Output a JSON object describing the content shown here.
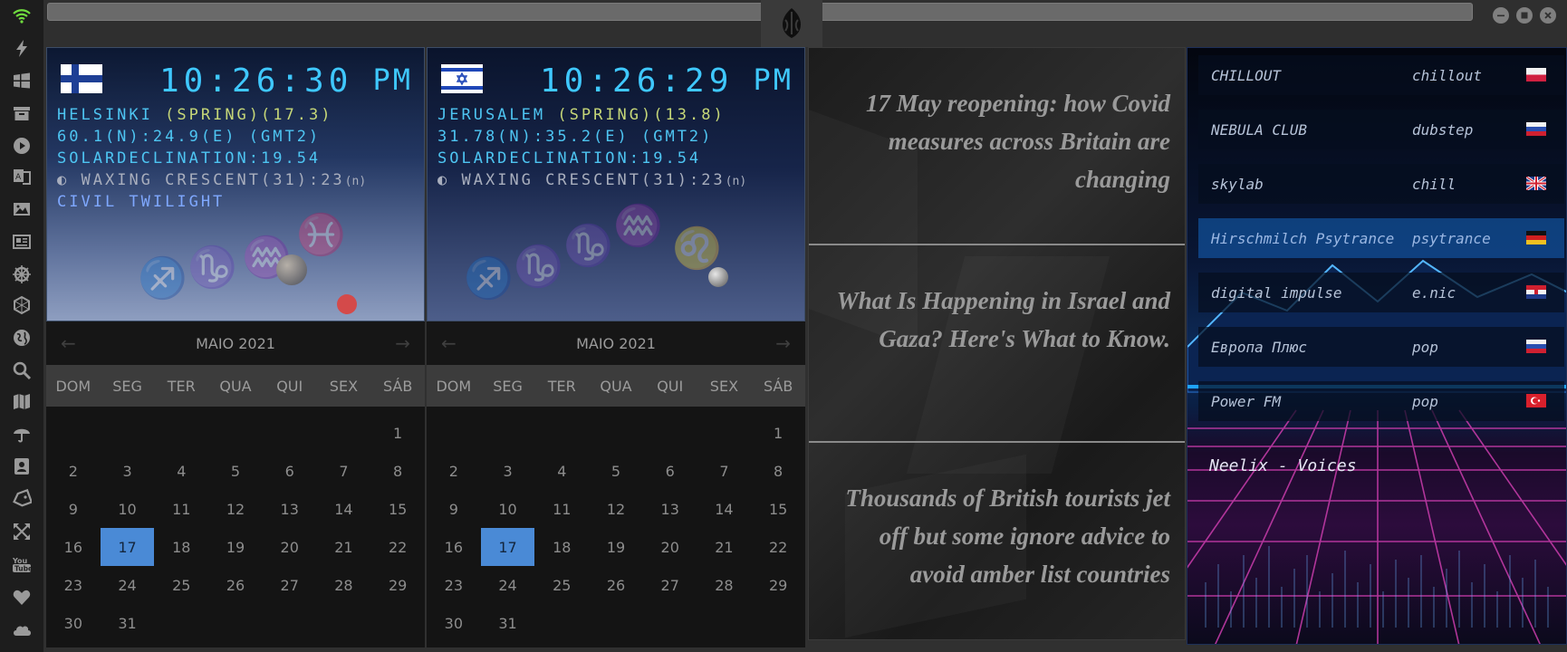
{
  "topbar": {
    "search_value": "",
    "window_controls": [
      "minimize-icon",
      "maximize-icon",
      "close-icon"
    ],
    "logo": "rebel-alliance-logo"
  },
  "sidebar": {
    "items": [
      {
        "name": "wifi-icon"
      },
      {
        "name": "lightning-icon"
      },
      {
        "name": "windows-icon"
      },
      {
        "name": "archive-icon"
      },
      {
        "name": "play-circle-icon"
      },
      {
        "name": "translate-icon"
      },
      {
        "name": "image-icon"
      },
      {
        "name": "newspaper-icon"
      },
      {
        "name": "helm-icon"
      },
      {
        "name": "hexagon-icon"
      },
      {
        "name": "globe-icon"
      },
      {
        "name": "search-icon"
      },
      {
        "name": "map-icon"
      },
      {
        "name": "umbrella-icon"
      },
      {
        "name": "contact-icon"
      },
      {
        "name": "tag-icon"
      },
      {
        "name": "expand-icon"
      },
      {
        "name": "youtube-icon"
      },
      {
        "name": "heart-icon"
      },
      {
        "name": "cloud-icon"
      }
    ]
  },
  "clocks": [
    {
      "flag": "finland",
      "time": "10:26:30",
      "ampm": "PM",
      "city": "HELSINKI",
      "season": "(SPRING)",
      "temp": "(17.3)",
      "coords": "60.1(N):24.9(E) (GMT2)",
      "solar": "SOLARDECLINATION:19.54",
      "moon": "WAXING CRESCENT(31):23",
      "moon_suffix": "(n)",
      "twilight": "CIVIL TWILIGHT"
    },
    {
      "flag": "israel",
      "time": "10:26:29",
      "ampm": "PM",
      "city": "JERUSALEM",
      "season": "(SPRING)",
      "temp": "(13.8)",
      "coords": "31.78(N):35.2(E) (GMT2)",
      "solar": "SOLARDECLINATION:19.54",
      "moon": "WAXING CRESCENT(31):23",
      "moon_suffix": "(n)",
      "twilight": ""
    }
  ],
  "calendars": [
    {
      "month": "MAIO 2021",
      "weekdays": [
        "DOM",
        "SEG",
        "TER",
        "QUA",
        "QUI",
        "SEX",
        "SÁB"
      ],
      "first_weekday_index": 6,
      "days": 31,
      "selected": 17
    },
    {
      "month": "MAIO 2021",
      "weekdays": [
        "DOM",
        "SEG",
        "TER",
        "QUA",
        "QUI",
        "SEX",
        "SÁB"
      ],
      "first_weekday_index": 6,
      "days": 31,
      "selected": 17
    }
  ],
  "news": [
    {
      "headline": "17 May reopening: how Covid measures across Britain are changing"
    },
    {
      "headline": "What Is Happening in Israel and Gaza? Here's What to Know."
    },
    {
      "headline": "Thousands of British tourists jet off but some ignore advice to avoid amber list countries"
    }
  ],
  "radio": {
    "stations": [
      {
        "name": "CHILLOUT",
        "genre": "chillout",
        "flag": "poland"
      },
      {
        "name": "NEBULA CLUB",
        "genre": "dubstep",
        "flag": "russia"
      },
      {
        "name": "skylab",
        "genre": "chill",
        "flag": "uk"
      },
      {
        "name": "Hirschmilch Psytrance",
        "genre": "psytrance",
        "flag": "germany"
      },
      {
        "name": "digital impulse",
        "genre": "e.nic",
        "flag": "croatia"
      },
      {
        "name": "Европа Плюс",
        "genre": "pop",
        "flag": "russia"
      },
      {
        "name": "Power FM",
        "genre": "pop",
        "flag": "turkey"
      }
    ],
    "active_index": 3,
    "now_playing": "Neelix - Voices"
  },
  "colors": {
    "clock_text": "#3fc8ff",
    "season": "#c6d778",
    "calendar_selected": "#4a8ad6",
    "news_text": "#9a9a9a"
  }
}
